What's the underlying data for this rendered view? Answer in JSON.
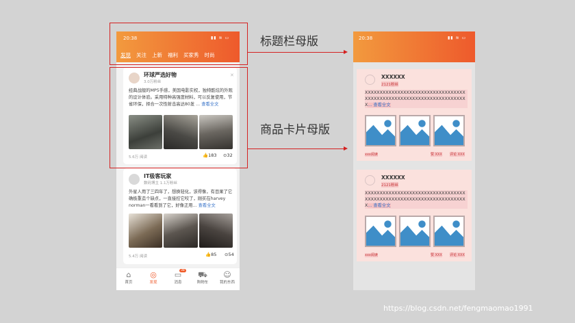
{
  "phone": {
    "time": "20:38",
    "status_icons": "▮▮ ≋ ▭",
    "tabs": [
      "发现",
      "关注",
      "上新",
      "福利",
      "买家秀",
      "时尚"
    ],
    "cards": [
      {
        "name": "环球严选好物",
        "sub": "3.0万粉丝",
        "text": "经典战舰的MP5手感，美国电影实权，独特酷炫的外观的设计体验。采用特种高强度材料，可以反复使用，节省环保，择合一次性射击高达80发 ...",
        "more": "查看全文",
        "stat": "5.6万 阅读",
        "likes": "183",
        "comments": "32"
      },
      {
        "name": "IT极客玩家",
        "sub": "数码博主 1.1万粉丝",
        "text": "外星人用了三四年了，想换轻化，该得像，有目果了它确极重造个缺点，一直接控它咬了，刚买在harvey norman一看看到了它，好像正用...",
        "more": "查看全文",
        "stat": "5.4万 阅读",
        "likes": "85",
        "comments": "54"
      }
    ],
    "nav": [
      {
        "label": "首页",
        "icon": "home-icon",
        "glyph": "⌂"
      },
      {
        "label": "发现",
        "icon": "discover-icon",
        "glyph": "◎"
      },
      {
        "label": "消息",
        "icon": "message-icon",
        "glyph": "▭",
        "badge": "38"
      },
      {
        "label": "购物车",
        "icon": "cart-icon",
        "glyph": "⛟"
      },
      {
        "label": "我的东西",
        "icon": "profile-icon",
        "glyph": "☺"
      }
    ]
  },
  "callouts": {
    "title_master": "标题栏母版",
    "card_master": "商品卡片母版"
  },
  "template": {
    "time": "20:38",
    "status_icons": "▮▮ ≋ ▭",
    "cards": [
      {
        "name": "XXXXXX",
        "sub": "2121粉丝",
        "text": "XXXXXXXXXXXXXXXXXXXXXXXXXXXXXXXXXXXXXXXXXXXXXXXXXXXXXXXXXXXXXXXXXXXXX",
        "more": "... 查看全文",
        "read": "xxx阅读",
        "like": "赞 XXX",
        "comment": "评论 XXX"
      },
      {
        "name": "XXXXXX",
        "sub": "2121粉丝",
        "text": "XXXXXXXXXXXXXXXXXXXXXXXXXXXXXXXXXXXXXXXXXXXXXXXXXXXXXXXXXXXXXXXXXXXXX",
        "more": "... 查看全文",
        "read": "xxx阅读",
        "like": "赞 XXX",
        "comment": "评论 XXX"
      }
    ]
  },
  "watermark": "https://blog.csdn.net/fengmaomao1991",
  "colors": {
    "accent": "#ee5a2c",
    "box": "#d42020",
    "tpl_card": "#fbe1dd",
    "tpl_img": "#3f8ec8"
  }
}
